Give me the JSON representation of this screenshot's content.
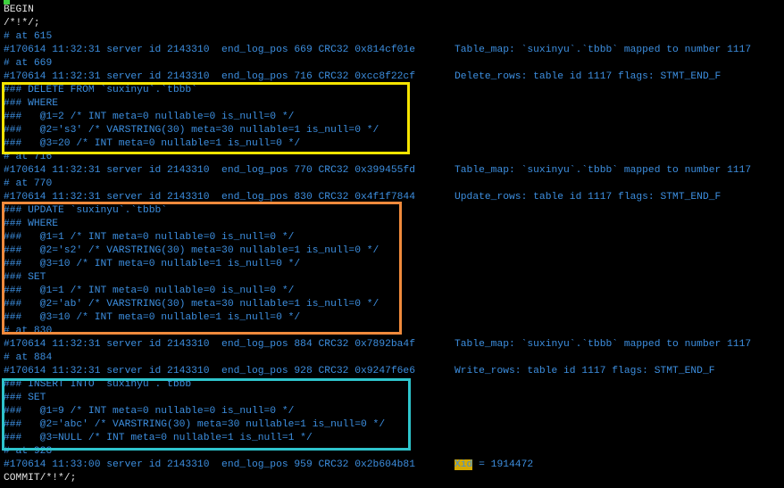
{
  "terminal": {
    "colors": {
      "text": "#e4e4e4",
      "comment": "#3d8fe0",
      "cursor": "#3fd13f",
      "highlight": "#d4a900",
      "box_delete": "#f5e400",
      "box_update": "#f08a3c",
      "box_insert": "#2ec4cc"
    },
    "lines": [
      {
        "text": "BEGIN",
        "style": "white"
      },
      {
        "text": "/*!*/;",
        "style": "white"
      },
      {
        "text": "# at 615"
      },
      {
        "text": "#170614 11:32:31 server id 2143310  end_log_pos 669 CRC32 0x814cf01e",
        "right": "Table_map: `suxinyu`.`tbbb` mapped to number 1117"
      },
      {
        "text": "# at 669"
      },
      {
        "text": "#170614 11:32:31 server id 2143310  end_log_pos 716 CRC32 0xcc8f22cf",
        "right": "Delete_rows: table id 1117 flags: STMT_END_F"
      },
      {
        "text": "### DELETE FROM `suxinyu`.`tbbb`"
      },
      {
        "text": "### WHERE"
      },
      {
        "text": "###   @1=2 /* INT meta=0 nullable=0 is_null=0 */"
      },
      {
        "text": "###   @2='s3' /* VARSTRING(30) meta=30 nullable=1 is_null=0 */"
      },
      {
        "text": "###   @3=20 /* INT meta=0 nullable=1 is_null=0 */"
      },
      {
        "text": "# at 716"
      },
      {
        "text": "#170614 11:32:31 server id 2143310  end_log_pos 770 CRC32 0x399455fd",
        "right": "Table_map: `suxinyu`.`tbbb` mapped to number 1117"
      },
      {
        "text": "# at 770"
      },
      {
        "text": "#170614 11:32:31 server id 2143310  end_log_pos 830 CRC32 0x4f1f7844",
        "right": "Update_rows: table id 1117 flags: STMT_END_F"
      },
      {
        "text": "### UPDATE `suxinyu`.`tbbb`"
      },
      {
        "text": "### WHERE"
      },
      {
        "text": "###   @1=1 /* INT meta=0 nullable=0 is_null=0 */"
      },
      {
        "text": "###   @2='s2' /* VARSTRING(30) meta=30 nullable=1 is_null=0 */"
      },
      {
        "text": "###   @3=10 /* INT meta=0 nullable=1 is_null=0 */"
      },
      {
        "text": "### SET"
      },
      {
        "text": "###   @1=1 /* INT meta=0 nullable=0 is_null=0 */"
      },
      {
        "text": "###   @2='ab' /* VARSTRING(30) meta=30 nullable=1 is_null=0 */"
      },
      {
        "text": "###   @3=10 /* INT meta=0 nullable=1 is_null=0 */"
      },
      {
        "text": "# at 830"
      },
      {
        "text": "#170614 11:32:31 server id 2143310  end_log_pos 884 CRC32 0x7892ba4f",
        "right": "Table_map: `suxinyu`.`tbbb` mapped to number 1117"
      },
      {
        "text": "# at 884"
      },
      {
        "text": "#170614 11:32:31 server id 2143310  end_log_pos 928 CRC32 0x9247f6e6",
        "right": "Write_rows: table id 1117 flags: STMT_END_F"
      },
      {
        "text": "### INSERT INTO `suxinyu`.`tbbb`"
      },
      {
        "text": "### SET"
      },
      {
        "text": "###   @1=9 /* INT meta=0 nullable=0 is_null=0 */"
      },
      {
        "text": "###   @2='abc' /* VARSTRING(30) meta=30 nullable=1 is_null=0 */"
      },
      {
        "text": "###   @3=NULL /* INT meta=0 nullable=1 is_null=1 */"
      },
      {
        "text": "# at 928"
      },
      {
        "text": "#170614 11:33:00 server id 2143310  end_log_pos 959 CRC32 0x2b604b81",
        "right_highlight": "Xid",
        "right": " = 1914472"
      },
      {
        "text": "COMMIT/*!*/;",
        "style": "white"
      }
    ]
  }
}
